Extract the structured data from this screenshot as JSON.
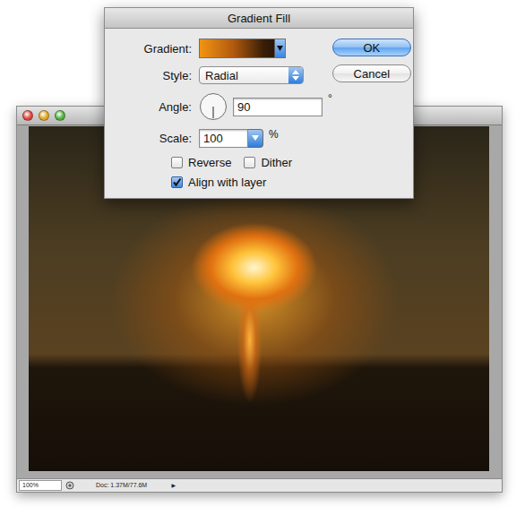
{
  "dialog": {
    "title": "Gradient Fill",
    "gradient": {
      "label": "Gradient:"
    },
    "style": {
      "label": "Style:",
      "value": "Radial"
    },
    "angle": {
      "label": "Angle:",
      "value": "90",
      "unit": "°"
    },
    "scale": {
      "label": "Scale:",
      "value": "100",
      "unit": "%"
    },
    "checkboxes": [
      {
        "label": "Reverse",
        "checked": false
      },
      {
        "label": "Dither",
        "checked": false
      },
      {
        "label": "Align with layer",
        "checked": true
      }
    ],
    "buttons": [
      {
        "label": "OK",
        "default": true
      },
      {
        "label": "Cancel",
        "default": false
      }
    ]
  },
  "document": {
    "zoom": "100%",
    "status": "Doc: 1.37M/77.6M",
    "menu_arrow": "▶"
  }
}
